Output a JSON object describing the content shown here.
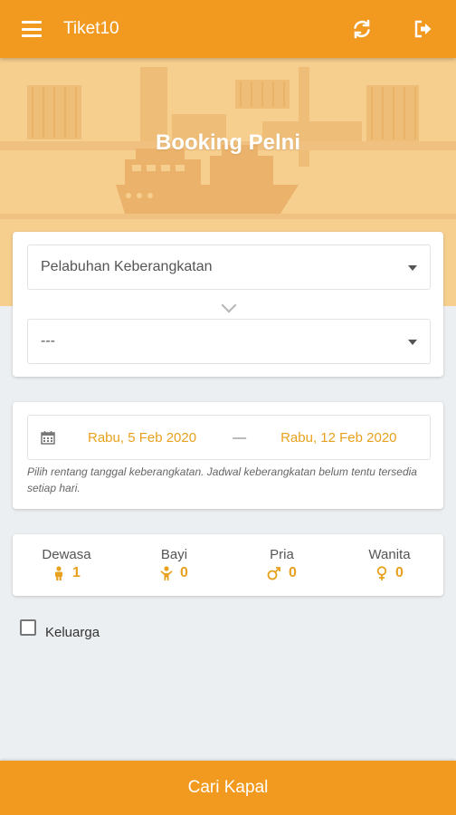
{
  "appbar": {
    "title": "Tiket10",
    "menu_icon": "hamburger-icon",
    "refresh_icon": "refresh-icon",
    "logout_icon": "logout-icon"
  },
  "hero": {
    "heading": "Booking Pelni"
  },
  "route": {
    "origin_placeholder": "Pelabuhan Keberangkatan",
    "destination_value": "---"
  },
  "dates": {
    "start": "Rabu, 5 Feb 2020",
    "separator": "—",
    "end": "Rabu, 12 Feb 2020",
    "hint": "Pilih rentang tanggal keberangkatan. Jadwal keberangkatan belum tentu tersedia setiap hari."
  },
  "passengers": [
    {
      "label": "Dewasa",
      "count": "1",
      "icon": "adult-icon"
    },
    {
      "label": "Bayi",
      "count": "0",
      "icon": "infant-icon"
    },
    {
      "label": "Pria",
      "count": "0",
      "icon": "male-icon"
    },
    {
      "label": "Wanita",
      "count": "0",
      "icon": "female-icon"
    }
  ],
  "family": {
    "label": "Keluarga",
    "checked": false
  },
  "action": {
    "search_label": "Cari Kapal"
  },
  "colors": {
    "primary": "#f29a1f",
    "accent_text": "#e8a11e",
    "hero_bg": "#f6cf8f",
    "page_bg": "#eceff1"
  }
}
